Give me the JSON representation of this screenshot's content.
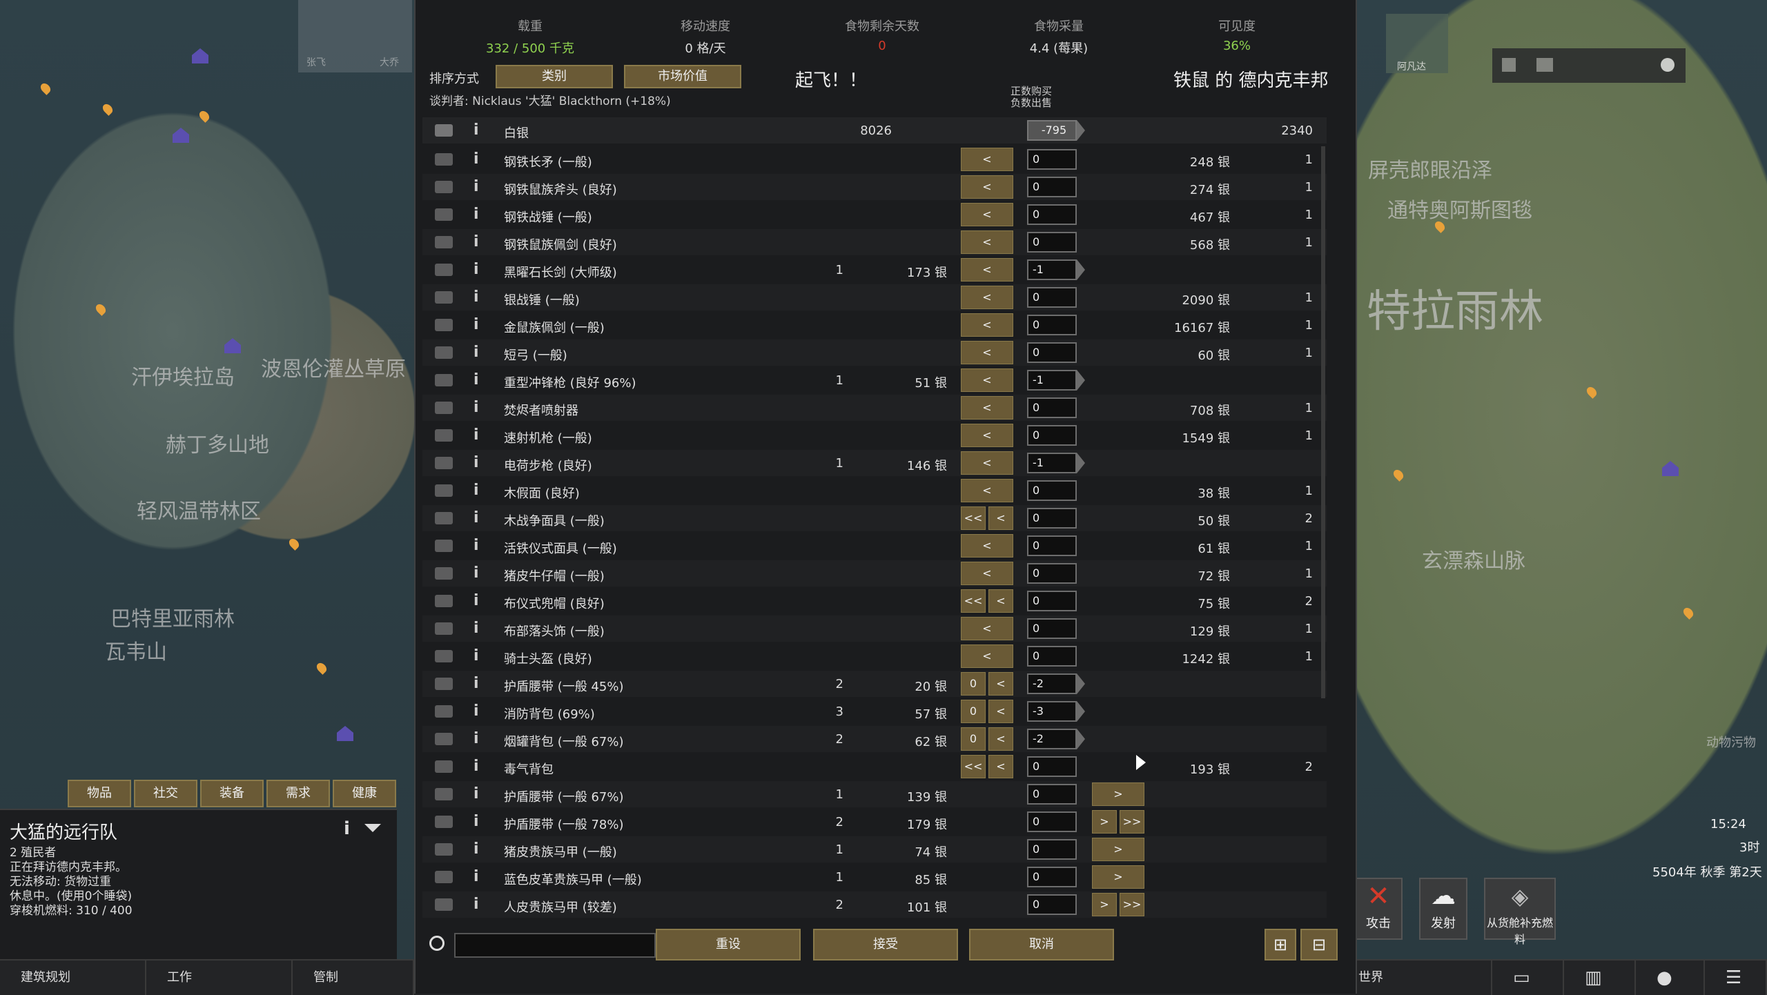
{
  "header": {
    "mass_label": "载重",
    "mass_value": "332 / 500 千克",
    "speed_label": "移动速度",
    "speed_value": "0 格/天",
    "food_label": "食物剩余天数",
    "food_value": "0",
    "forage_label": "食物采量",
    "forage_value": "4.4 (莓果)",
    "visibility_label": "可见度",
    "visibility_value": "36%"
  },
  "sort": {
    "label": "排序方式",
    "btn1": "类别",
    "btn2": "市场价值"
  },
  "caravan_shout": "起飞！！",
  "trader_name": "铁鼠 的 德内克丰邦",
  "negotiator": "谈判者: Nicklaus '大猛' Blackthorn (+18%)",
  "buy_sell_hint": "正数购买\n负数出售",
  "silver": {
    "name": "白银",
    "colony": "8026",
    "qty": "-795",
    "trader": "2340"
  },
  "rows": [
    {
      "icon": "spear-icon",
      "name": "钢铁长矛 (一般)",
      "cc": "",
      "cp": "",
      "left": "<",
      "qty": "0",
      "tp": "248 银",
      "tc": "1",
      "right": ""
    },
    {
      "icon": "axe-icon",
      "name": "钢铁鼠族斧头 (良好)",
      "cc": "",
      "cp": "",
      "left": "<",
      "qty": "0",
      "tp": "274 银",
      "tc": "1",
      "right": ""
    },
    {
      "icon": "warhammer-icon",
      "name": "钢铁战锤 (一般)",
      "cc": "",
      "cp": "",
      "left": "<",
      "qty": "0",
      "tp": "467 银",
      "tc": "1",
      "right": ""
    },
    {
      "icon": "sword-icon",
      "name": "钢铁鼠族佩剑 (良好)",
      "cc": "",
      "cp": "",
      "left": "<",
      "qty": "0",
      "tp": "568 银",
      "tc": "1",
      "right": ""
    },
    {
      "icon": "longsword-icon",
      "name": "黑曜石长剑 (大师级)",
      "cc": "1",
      "cp": "173 银",
      "left": "<",
      "qty": "-1",
      "tp": "",
      "tc": "",
      "right": ""
    },
    {
      "icon": "warhammer-icon",
      "name": "银战锤 (一般)",
      "cc": "",
      "cp": "",
      "left": "<",
      "qty": "0",
      "tp": "2090 银",
      "tc": "1",
      "right": ""
    },
    {
      "icon": "sword-icon",
      "name": "金鼠族佩剑 (一般)",
      "cc": "",
      "cp": "",
      "left": "<",
      "qty": "0",
      "tp": "16167 银",
      "tc": "1",
      "right": ""
    },
    {
      "icon": "bow-icon",
      "name": "短弓 (一般)",
      "cc": "",
      "cp": "",
      "left": "<",
      "qty": "0",
      "tp": "60 银",
      "tc": "1",
      "right": ""
    },
    {
      "icon": "smg-icon",
      "name": "重型冲锋枪 (良好 96%)",
      "cc": "1",
      "cp": "51 银",
      "left": "<",
      "qty": "-1",
      "tp": "",
      "tc": "",
      "right": ""
    },
    {
      "icon": "flamethrower-icon",
      "name": "焚烬者喷射器",
      "cc": "",
      "cp": "",
      "left": "<",
      "qty": "0",
      "tp": "708 银",
      "tc": "1",
      "right": ""
    },
    {
      "icon": "machinegun-icon",
      "name": "速射机枪 (一般)",
      "cc": "",
      "cp": "",
      "left": "<",
      "qty": "0",
      "tp": "1549 银",
      "tc": "1",
      "right": ""
    },
    {
      "icon": "rifle-icon",
      "name": "电荷步枪 (良好)",
      "cc": "1",
      "cp": "146 银",
      "left": "<",
      "qty": "-1",
      "tp": "",
      "tc": "",
      "right": ""
    },
    {
      "icon": "mask-icon",
      "name": "木假面 (良好)",
      "cc": "",
      "cp": "",
      "left": "<",
      "qty": "0",
      "tp": "38 银",
      "tc": "1",
      "right": ""
    },
    {
      "icon": "mask-icon",
      "name": "木战争面具 (一般)",
      "cc": "",
      "cp": "",
      "left": "<< <",
      "qty": "0",
      "tp": "50 银",
      "tc": "2",
      "right": ""
    },
    {
      "icon": "mask-icon",
      "name": "活铁仪式面具 (一般)",
      "cc": "",
      "cp": "",
      "left": "<",
      "qty": "0",
      "tp": "61 银",
      "tc": "1",
      "right": ""
    },
    {
      "icon": "hat-icon",
      "name": "猪皮牛仔帽 (一般)",
      "cc": "",
      "cp": "",
      "left": "<",
      "qty": "0",
      "tp": "72 银",
      "tc": "1",
      "right": ""
    },
    {
      "icon": "hood-icon",
      "name": "布仪式兜帽 (良好)",
      "cc": "",
      "cp": "",
      "left": "<< <",
      "qty": "0",
      "tp": "75 银",
      "tc": "2",
      "right": ""
    },
    {
      "icon": "headdress-icon",
      "name": "布部落头饰 (一般)",
      "cc": "",
      "cp": "",
      "left": "<",
      "qty": "0",
      "tp": "129 银",
      "tc": "1",
      "right": ""
    },
    {
      "icon": "helmet-icon",
      "name": "骑士头盔 (良好)",
      "cc": "",
      "cp": "",
      "left": "<",
      "qty": "0",
      "tp": "1242 银",
      "tc": "1",
      "right": ""
    },
    {
      "icon": "shieldbelt-icon",
      "name": "护盾腰带 (一般 45%)",
      "cc": "2",
      "cp": "20 银",
      "left": "0 <",
      "qty": "-2",
      "tp": "",
      "tc": "",
      "right": ""
    },
    {
      "icon": "pack-icon",
      "name": "消防背包 (69%)",
      "cc": "3",
      "cp": "57 银",
      "left": "0 <",
      "qty": "-3",
      "tp": "",
      "tc": "",
      "right": ""
    },
    {
      "icon": "pack-icon",
      "name": "烟罐背包 (一般 67%)",
      "cc": "2",
      "cp": "62 银",
      "left": "0 <",
      "qty": "-2",
      "tp": "",
      "tc": "",
      "right": ""
    },
    {
      "icon": "gaspack-icon",
      "name": "毒气背包",
      "cc": "",
      "cp": "",
      "left": "<< <",
      "qty": "0",
      "tp": "193 银",
      "tc": "2",
      "right": ""
    },
    {
      "icon": "shieldbelt-icon",
      "name": "护盾腰带 (一般 67%)",
      "cc": "1",
      "cp": "139 银",
      "left": "",
      "qty": "0",
      "tp": "",
      "tc": "",
      "right": ">"
    },
    {
      "icon": "shieldbelt-icon",
      "name": "护盾腰带 (一般 78%)",
      "cc": "2",
      "cp": "179 银",
      "left": "",
      "qty": "0",
      "tp": "",
      "tc": "",
      "right": "> >>"
    },
    {
      "icon": "armor-icon",
      "name": "猪皮贵族马甲 (一般)",
      "cc": "1",
      "cp": "74 银",
      "left": "",
      "qty": "0",
      "tp": "",
      "tc": "",
      "right": ">"
    },
    {
      "icon": "armor-icon",
      "name": "蓝色皮革贵族马甲 (一般)",
      "cc": "1",
      "cp": "85 银",
      "left": "",
      "qty": "0",
      "tp": "",
      "tc": "",
      "right": ">"
    },
    {
      "icon": "armor-icon",
      "name": "人皮贵族马甲 (较差)",
      "cc": "2",
      "cp": "101 银",
      "left": "",
      "qty": "0",
      "tp": "",
      "tc": "",
      "right": "> >>"
    }
  ],
  "footer": {
    "reset": "重设",
    "accept": "接受",
    "cancel": "取消"
  },
  "caravan": {
    "tabs": [
      "物品",
      "社交",
      "装备",
      "需求",
      "健康"
    ],
    "title": "大猛的远行队",
    "line1": "2 殖民者",
    "line2": "正在拜访德内克丰邦。",
    "line3": "无法移动: 货物过重",
    "line4": "休息中。(使用0个睡袋)",
    "line5": "穿梭机燃料: 310 / 400"
  },
  "map_labels": [
    "汗伊埃拉岛",
    "波恩伦灌丛草原",
    "赫丁多山地",
    "轻风温带林区",
    "巴特里亚雨林",
    "瓦韦山",
    "特拉雨林",
    "玄漂森山脉",
    "屏壳郎眼沿泽",
    "通特奥阿斯图毯",
    "动物污物"
  ],
  "map_portraits": {
    "p1": "张飞",
    "p2": "大乔",
    "p3": "阿凡达"
  },
  "bottom_bar": [
    "建筑规划",
    "工作",
    "管制",
    "世界"
  ],
  "right_controls": {
    "attack": "攻击",
    "launch": "发射",
    "refuel": "从货舱补充燃料"
  },
  "clock": {
    "time": "15:24",
    "hour": "3时",
    "date": "5504年 秋季 第2天"
  },
  "colors": {
    "accent_green": "#8fd14f",
    "warning_red": "#d43a2a",
    "button_gold": "#6a5a36"
  }
}
